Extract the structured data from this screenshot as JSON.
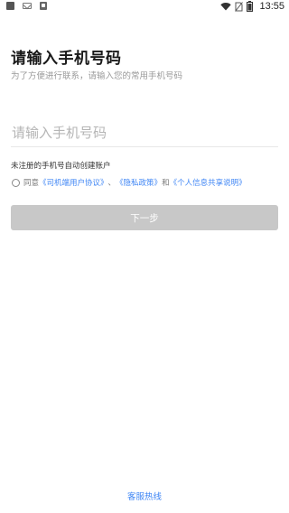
{
  "status_bar": {
    "time": "13:55",
    "left_icons": [
      "app-square-icon",
      "mail-icon",
      "app-a-icon"
    ],
    "right_icons": [
      "wifi-icon",
      "no-sim-icon",
      "battery-icon"
    ]
  },
  "login": {
    "title": "请输入手机号码",
    "subtitle": "为了方便进行联系，请输入您的常用手机号码",
    "phone_placeholder": "请输入手机号码",
    "phone_value": "",
    "hint": "未注册的手机号自动创建账户"
  },
  "agreement": {
    "prefix": "同意",
    "link_user_agreement": "《司机端用户协议》",
    "separator": "、",
    "link_privacy": "《隐私政策》",
    "conjunction": "和",
    "link_info_sharing": "《个人信息共享说明》",
    "checked": false
  },
  "actions": {
    "next_label": "下一步",
    "next_enabled": false
  },
  "footer": {
    "hotline_label": "客服热线"
  },
  "colors": {
    "link": "#3f86f5",
    "button_disabled": "#c8c8c8",
    "title": "#1a1a1a",
    "subtitle": "#999999"
  }
}
